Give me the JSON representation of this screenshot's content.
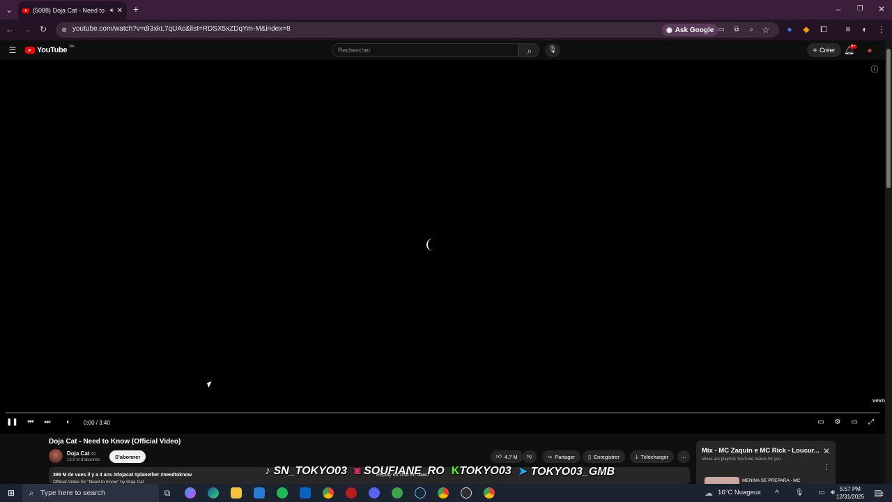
{
  "browser": {
    "tab_title": "(5088) Doja Cat - Need to K",
    "url": "youtube.com/watch?v=dI3xkL7qUAc&list=RDSX5xZDqYm-M&index=8",
    "ask_google": "Ask Google"
  },
  "youtube": {
    "logo": "YouTube",
    "logo_country": "MA",
    "search_placeholder": "Rechercher",
    "create_label": "Créer",
    "notifications_badge": "9+"
  },
  "player": {
    "time": "0:00 / 3:40",
    "vevo": "vevo",
    "progress": 0
  },
  "video": {
    "title": "Doja Cat - Need to Know (Official Video)",
    "channel": "Doja Cat",
    "verified": "⊙",
    "subscribers": "13,9 M d'abonnés",
    "subscribe_label": "S'abonner",
    "likes": "4,7 M",
    "share_label": "Partager",
    "save_label": "Enregistrer",
    "download_label": "Télécharger",
    "description_meta": "399 M de vues  il y a 4 ans  #dojacat #planether #needtoknow",
    "description_text": "Official Video for \"Need to Know\" by Doja Cat"
  },
  "mix": {
    "title": "Mix - MC Zaquin e MC Rick - Loucur...",
    "subtitle": "Mixes are playlists YouTube makes for you",
    "first_item": "MENINA SE PREPARA - MC"
  },
  "overlay": {
    "tiktok": "SN_TOKYO03",
    "instagram": "SOUFIANE_RO",
    "kick": "TOKYO03",
    "telegram": "TOKYO03_GMB",
    "replay": "Replay du chat en direct"
  },
  "taskbar": {
    "search_placeholder": "Type here to search",
    "weather": "16°C  Nuageux",
    "time": "5:57 PM",
    "date": "12/31/2025",
    "notification_count": "2"
  },
  "colors": {
    "tab_bar": "#3b1f3a",
    "youtube_red": "#ff0000",
    "taskbar": "#1c2330"
  }
}
